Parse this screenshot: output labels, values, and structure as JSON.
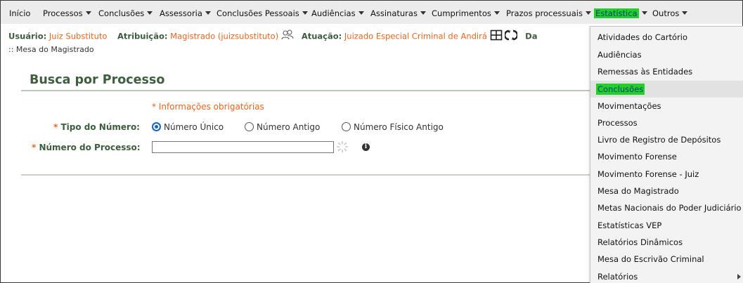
{
  "menu": {
    "items": [
      {
        "label": "Início",
        "has_caret": false
      },
      {
        "label": "Processos",
        "has_caret": true
      },
      {
        "label": "Conclusões",
        "has_caret": true
      },
      {
        "label": "Assessoria",
        "has_caret": true
      },
      {
        "label": "Conclusões Pessoais",
        "has_caret": true
      },
      {
        "label": "Audiências",
        "has_caret": true
      },
      {
        "label": "Assinaturas",
        "has_caret": true
      },
      {
        "label": "Cumprimentos",
        "has_caret": true
      },
      {
        "label": "Prazos processuais",
        "has_caret": true
      },
      {
        "label": "Estatística",
        "has_caret": true,
        "active": true
      },
      {
        "label": "Outros",
        "has_caret": true
      }
    ],
    "active_color": "#22d126"
  },
  "user_info": {
    "user_label": "Usuário:",
    "user_value": "Juiz Substituto",
    "role_label": "Atribuição:",
    "role_value": "Magistrado (juizsubstituto)",
    "unit_label": "Atuação:",
    "unit_value": "Juizado Especial Criminal de Andirá",
    "truncated_label": "Da"
  },
  "breadcrumb": ":: Mesa do Magistrado",
  "panel": {
    "title": "Busca por Processo",
    "required_note": "* Informações obrigatórias",
    "number_type": {
      "label": "Tipo do Número:",
      "options": [
        {
          "label": "Número Único",
          "checked": true
        },
        {
          "label": "Número Antigo",
          "checked": false
        },
        {
          "label": "Número Físico Antigo",
          "checked": false
        }
      ]
    },
    "process_number": {
      "label": "Número do Processo:",
      "value": "",
      "placeholder": ""
    }
  },
  "dropdown": {
    "items": [
      {
        "label": "Atividades do Cartório"
      },
      {
        "label": "Audiências"
      },
      {
        "label": "Remessas às Entidades"
      },
      {
        "label": "Conclusões",
        "active": true
      },
      {
        "label": "Movimentações"
      },
      {
        "label": "Processos"
      },
      {
        "label": "Livro de Registro de Depósitos"
      },
      {
        "label": "Movimento Forense"
      },
      {
        "label": "Movimento Forense - Juiz"
      },
      {
        "label": "Mesa do Magistrado"
      },
      {
        "label": "Metas Nacionais do Poder Judiciário"
      },
      {
        "label": "Estatísticas VEP"
      },
      {
        "label": "Relatórios Dinâmicos"
      },
      {
        "label": "Mesa do Escrivão Criminal"
      },
      {
        "label": "Relatórios",
        "has_submenu": true
      }
    ]
  },
  "colors": {
    "label_green": "#3d5c3d",
    "value_orange": "#e8661f",
    "highlight_green": "#22d126",
    "highlight_text": "#0a3a8c"
  }
}
